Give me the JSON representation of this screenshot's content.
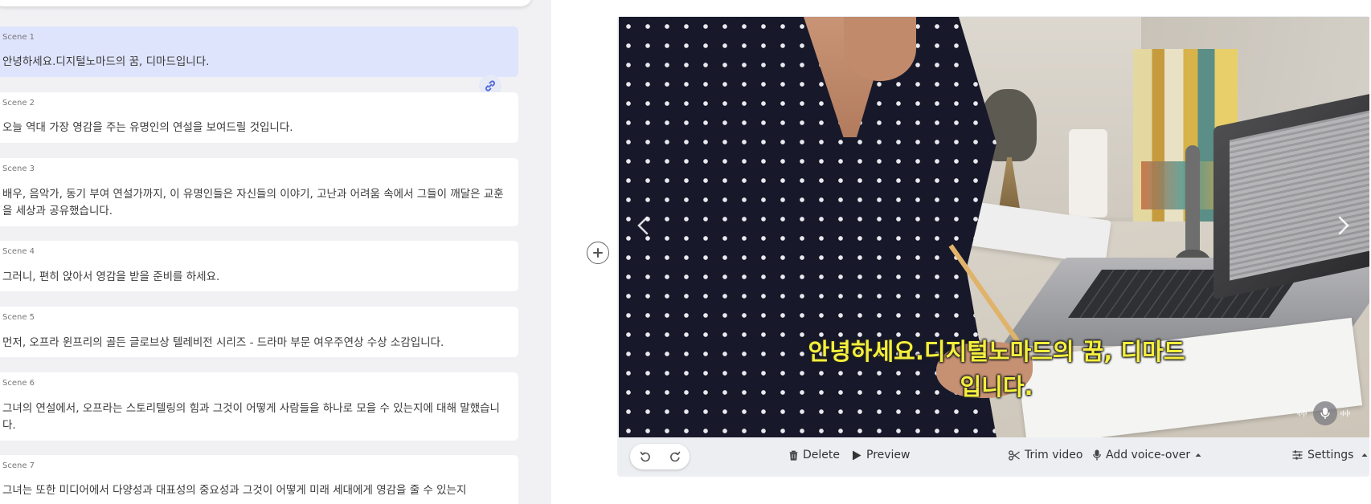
{
  "scenes": [
    {
      "label": "Scene 1",
      "text": "안녕하세요.디지털노마드의 꿈, 디마드입니다."
    },
    {
      "label": "Scene 2",
      "text": "오늘 역대 가장 영감을 주는 유명인의 연설을 보여드릴 것입니다."
    },
    {
      "label": "Scene 3",
      "text": "배우, 음악가, 동기 부여 연설가까지, 이 유명인들은 자신들의 이야기, 고난과 어려움 속에서 그들이 깨달은 교훈을 세상과 공유했습니다."
    },
    {
      "label": "Scene 4",
      "text": "그러니, 편히 앉아서 영감을 받을 준비를 하세요."
    },
    {
      "label": "Scene 5",
      "text": "먼저, 오프라 윈프리의 골든 글로브상 텔레비전 시리즈 - 드라마 부문 여우주연상 수상 소감입니다."
    },
    {
      "label": "Scene 6",
      "text": "그녀의 연설에서, 오프라는 스토리텔링의 힘과 그것이 어떻게 사람들을 하나로 모을 수 있는지에 대해 말했습니다."
    },
    {
      "label": "Scene 7",
      "text": "그녀는 또한 미디어에서 다양성과 대표성의 중요성과 그것이 어떻게 미래 세대에게 영감을 줄 수 있는지"
    }
  ],
  "preview": {
    "subtitle_line1": "안녕하세요.디지털노마드의 꿈, 디마드",
    "subtitle_line2": "입니다."
  },
  "toolbar": {
    "delete_label": "Delete",
    "preview_label": "Preview",
    "trim_label": "Trim video",
    "voiceover_label": "Add voice-over",
    "settings_label": "Settings"
  },
  "icons": [
    "link-icon",
    "plus-icon",
    "chevron-left-icon",
    "chevron-right-icon",
    "microphone-icon",
    "undo-icon",
    "redo-icon",
    "trash-icon",
    "play-icon",
    "scissors-icon",
    "sliders-icon",
    "caret-up-icon"
  ],
  "colors": {
    "active_scene_bg": "#dfe4fd",
    "subtitle": "#f4ef3c",
    "panel_bg": "#f1f1f4"
  }
}
